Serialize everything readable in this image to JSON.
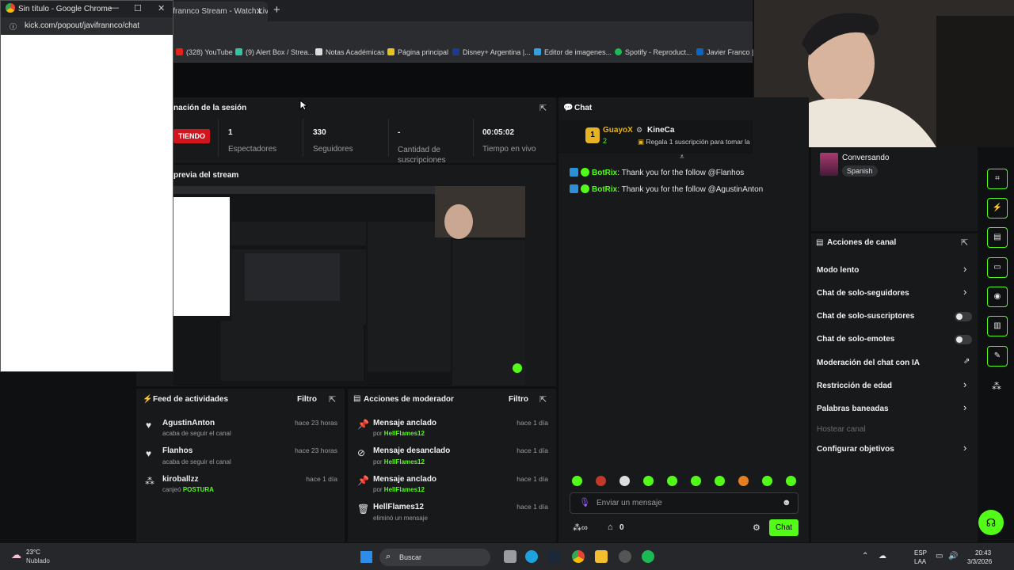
{
  "browser": {
    "popup_title": "Sin título - Google Chrome",
    "popup_url": "kick.com/popout/javifrannco/chat",
    "tab_title": "ifrannco Stream - Watch Liv",
    "bookmarks": [
      "(328) YouTube",
      "(9) Alert Box / Strea...",
      "Notas Académicas",
      "Página principal",
      "Disney+ Argentina |...",
      "Editor de imagenes...",
      "Spotify - Reproduct...",
      "Javier Franco | Li"
    ]
  },
  "session": {
    "title": "nación de la sesión",
    "live_badge": "TIENDO",
    "stats": [
      {
        "value": "1",
        "label": "Espectadores"
      },
      {
        "value": "330",
        "label": "Seguidores"
      },
      {
        "value": "-",
        "label": "Cantidad de suscripciones"
      },
      {
        "value": "00:05:02",
        "label": "Tiempo en vivo"
      }
    ]
  },
  "preview": {
    "title": "previa del stream"
  },
  "activity_feed": {
    "title": "Feed de actividades",
    "filter": "Filtro",
    "items": [
      {
        "name": "AgustinAnton",
        "detail": "acaba de seguir el canal",
        "time": "hace 23 horas"
      },
      {
        "name": "Flanhos",
        "detail": "acaba de seguir el canal",
        "time": "hace 23 horas"
      },
      {
        "name": "kiroballzz",
        "detail": "canjeó",
        "highlight": "POSTURA",
        "time": "hace 1 día"
      }
    ]
  },
  "mod_actions": {
    "title": "Acciones de moderador",
    "filter": "Filtro",
    "items": [
      {
        "name": "Mensaje anclado",
        "detail": "por",
        "user": "HellFlames12",
        "time": "hace 1 día"
      },
      {
        "name": "Mensaje desanclado",
        "detail": "por",
        "user": "HellFlames12",
        "time": "hace 1 día"
      },
      {
        "name": "Mensaje anclado",
        "detail": "por",
        "user": "HellFlames12",
        "time": "hace 1 día"
      },
      {
        "name": "HellFlames12",
        "detail": "eliminó un mensaje",
        "user": "",
        "time": "hace 1 día"
      }
    ]
  },
  "chat": {
    "title": "Chat",
    "pinned": {
      "rank": "1",
      "user1": "GuayoX",
      "count": "2",
      "user2": "KineCa",
      "gift_text": "Regala 1 suscripción para tomar la"
    },
    "messages": [
      {
        "user": "BotRix",
        "text": "Thank you for the follow @Flanhos"
      },
      {
        "user": "BotRix",
        "text": "Thank you for the follow @AgustinAnton"
      }
    ],
    "input_placeholder": "Enviar un mensaje",
    "points": "0",
    "send_label": "Chat"
  },
  "stream_info": {
    "category": "Conversando",
    "language": "Spanish"
  },
  "channel_actions": {
    "title": "Acciones de canal",
    "items": [
      {
        "label": "Modo lento",
        "control": "chevron"
      },
      {
        "label": "Chat de solo-seguidores",
        "control": "chevron"
      },
      {
        "label": "Chat de solo-suscriptores",
        "control": "toggle"
      },
      {
        "label": "Chat de solo-emotes",
        "control": "toggle"
      },
      {
        "label": "Moderación del chat con IA",
        "control": "external"
      },
      {
        "label": "Restricción de edad",
        "control": "chevron"
      },
      {
        "label": "Palabras baneadas",
        "control": "chevron"
      },
      {
        "label": "Hostear canal",
        "control": "disabled"
      },
      {
        "label": "Configurar objetivos",
        "control": "chevron"
      }
    ]
  },
  "taskbar": {
    "weather_temp": "23°C",
    "weather_desc": "Nublado",
    "search": "Buscar",
    "lang1": "ESP",
    "lang2": "LAA",
    "time": "20:43",
    "date": "3/3/2026"
  },
  "colors": {
    "accent": "#53fc18",
    "live": "#d1141d",
    "panel": "#18191b"
  }
}
